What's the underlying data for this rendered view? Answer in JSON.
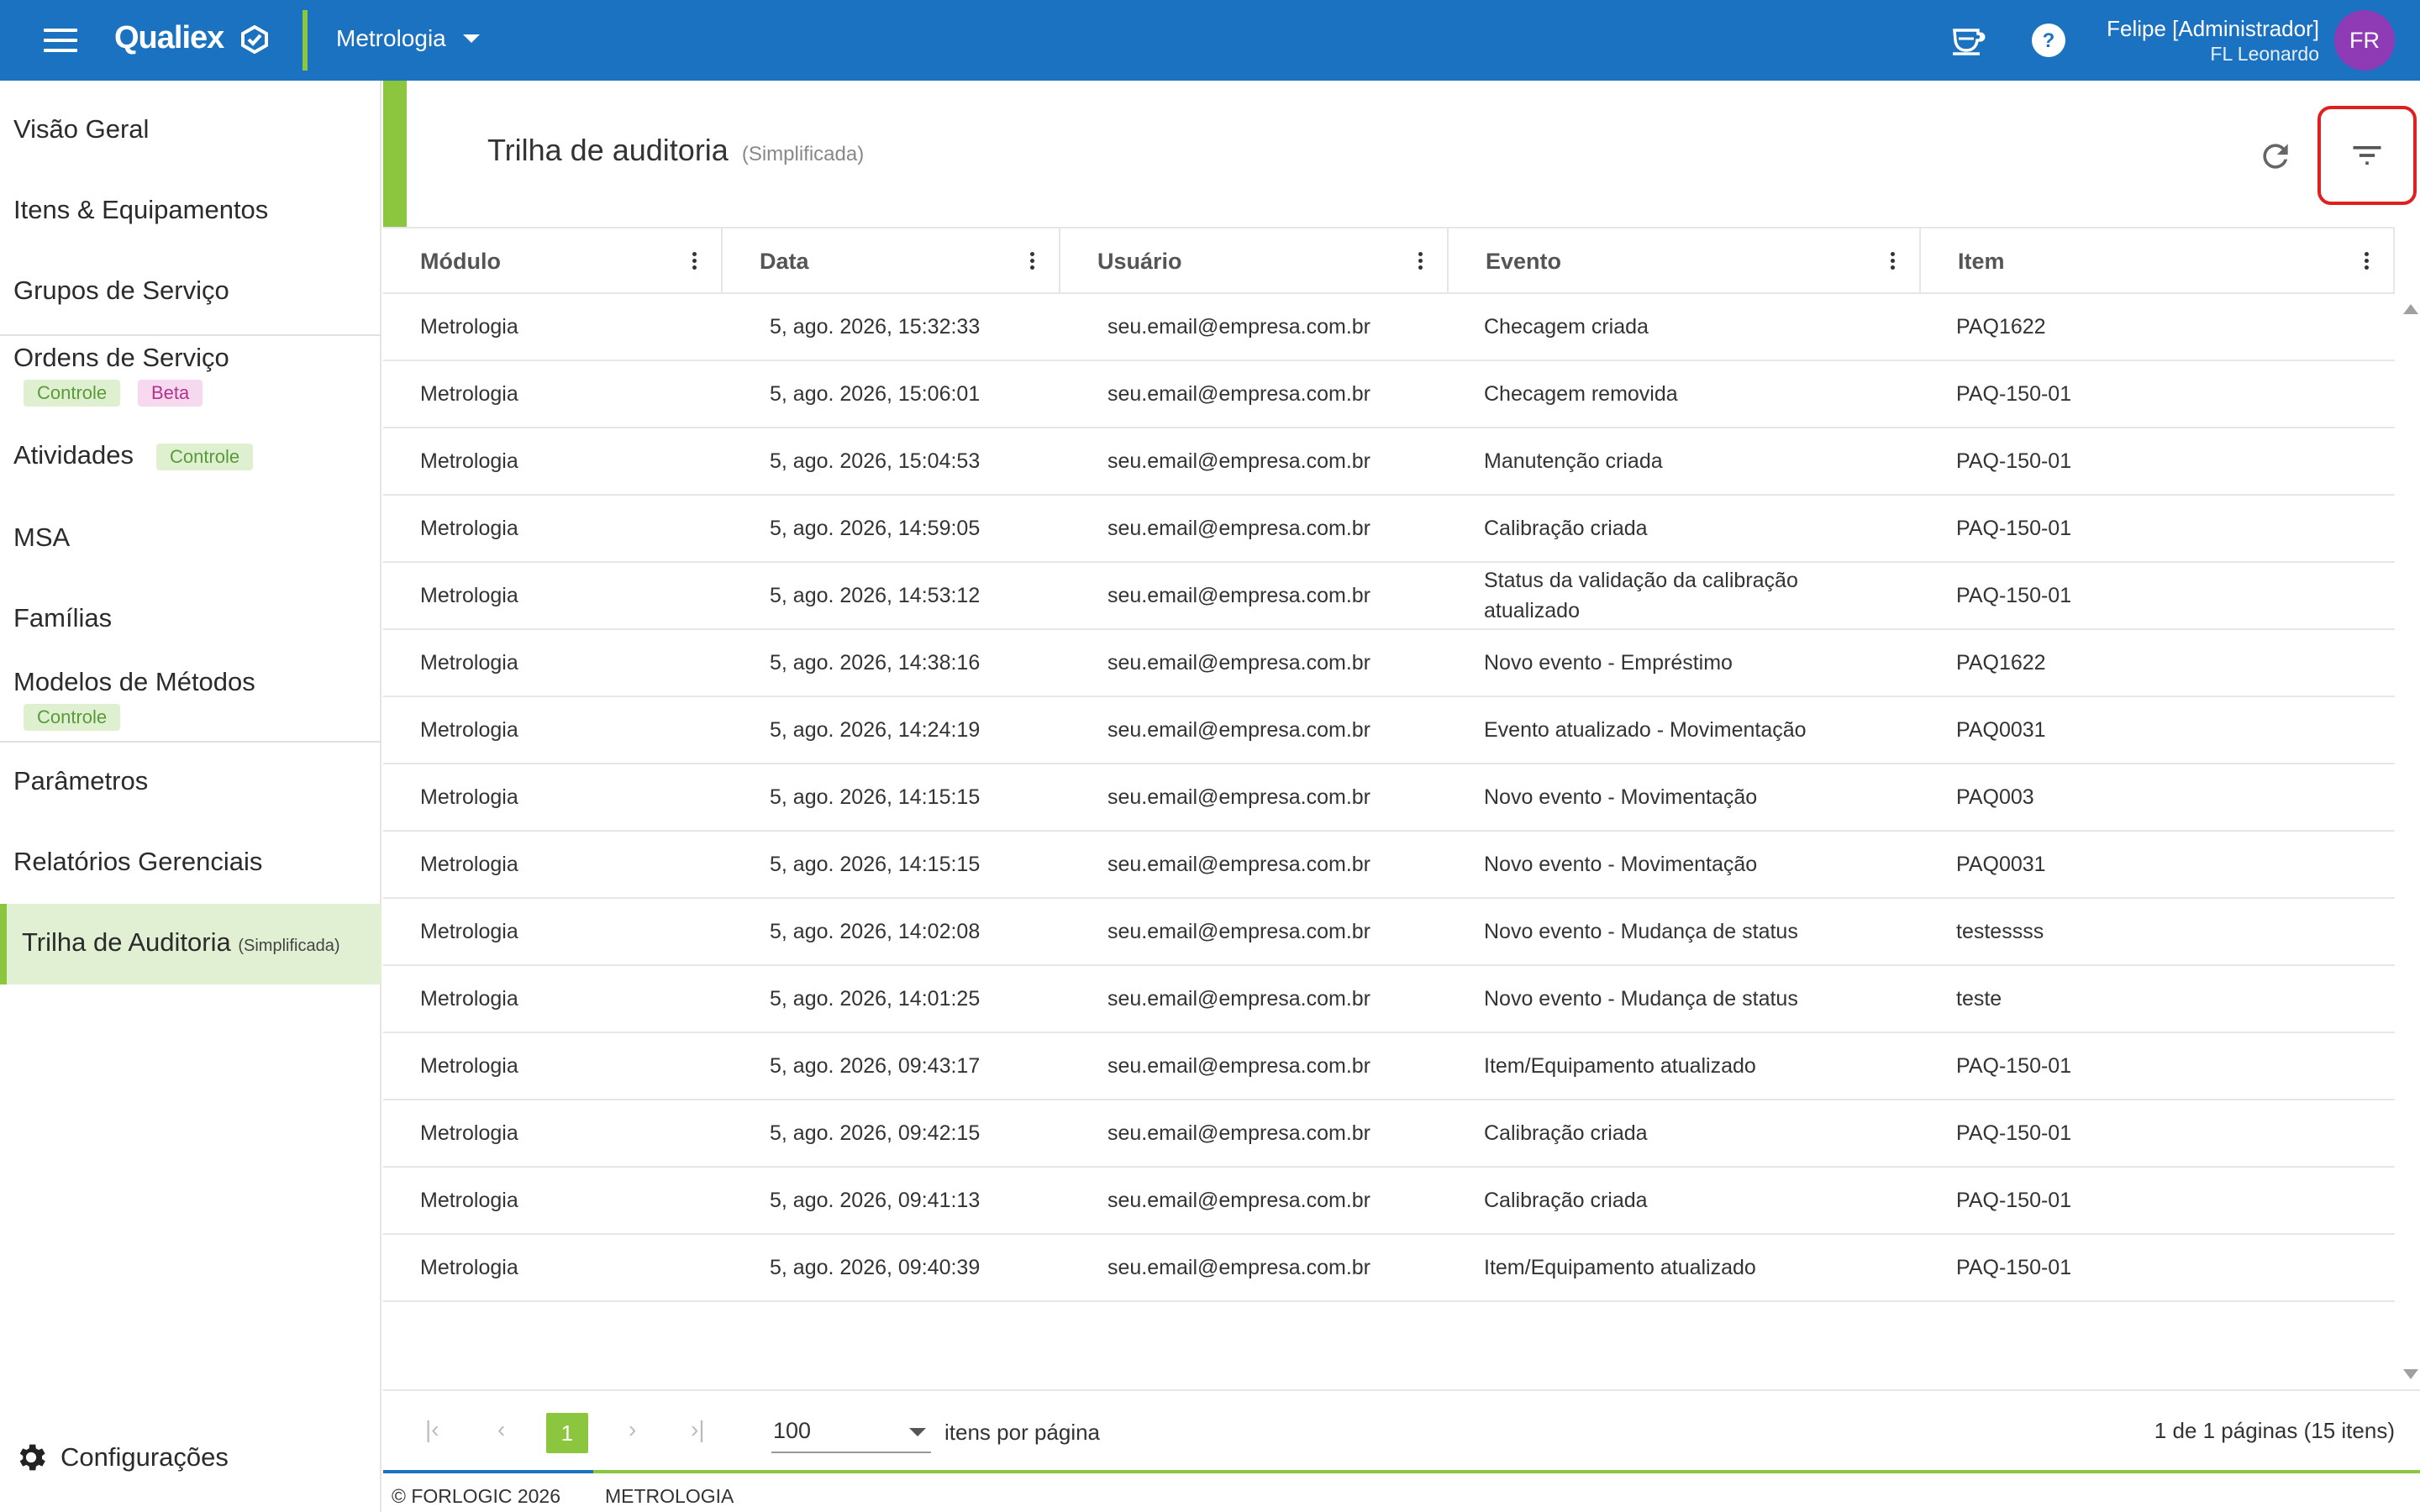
{
  "topbar": {
    "brand": "Qualiex",
    "module": "Metrologia",
    "user_name": "Felipe [Administrador]",
    "user_company": "FL Leonardo",
    "avatar_initials": "FR",
    "colors": {
      "bar": "#1b72c0",
      "accent": "#8cc63f",
      "avatar": "#8e3bb5"
    }
  },
  "sidebar": {
    "items": [
      {
        "label": "Visão Geral"
      },
      {
        "label": "Itens & Equipamentos"
      },
      {
        "label": "Grupos de Serviço"
      },
      {
        "label": "Ordens de Serviço",
        "badges": [
          "Controle",
          "Beta"
        ]
      },
      {
        "label": "Atividades",
        "badges": [
          "Controle"
        ]
      },
      {
        "label": "MSA"
      },
      {
        "label": "Famílias"
      },
      {
        "label": "Modelos de Métodos",
        "badges": [
          "Controle"
        ]
      },
      {
        "label": "Parâmetros"
      },
      {
        "label": "Relatórios Gerenciais"
      },
      {
        "label": "Trilha de Auditoria",
        "suffix": "(Simplificada)",
        "active": true
      }
    ],
    "settings_label": "Configurações"
  },
  "page": {
    "title": "Trilha de auditoria",
    "subtitle": "(Simplificada)"
  },
  "table": {
    "columns": [
      "Módulo",
      "Data",
      "Usuário",
      "Evento",
      "Item"
    ],
    "rows": [
      [
        "Metrologia",
        "5, ago. 2026, 15:32:33",
        "seu.email@empresa.com.br",
        "Checagem criada",
        "PAQ1622"
      ],
      [
        "Metrologia",
        "5, ago. 2026, 15:06:01",
        "seu.email@empresa.com.br",
        "Checagem removida",
        "PAQ-150-01"
      ],
      [
        "Metrologia",
        "5, ago. 2026, 15:04:53",
        "seu.email@empresa.com.br",
        "Manutenção criada",
        "PAQ-150-01"
      ],
      [
        "Metrologia",
        "5, ago. 2026, 14:59:05",
        "seu.email@empresa.com.br",
        "Calibração criada",
        "PAQ-150-01"
      ],
      [
        "Metrologia",
        "5, ago. 2026, 14:53:12",
        "seu.email@empresa.com.br",
        "Status da validação da calibração atualizado",
        "PAQ-150-01"
      ],
      [
        "Metrologia",
        "5, ago. 2026, 14:38:16",
        "seu.email@empresa.com.br",
        "Novo evento - Empréstimo",
        "PAQ1622"
      ],
      [
        "Metrologia",
        "5, ago. 2026, 14:24:19",
        "seu.email@empresa.com.br",
        "Evento atualizado - Movimentação",
        "PAQ0031"
      ],
      [
        "Metrologia",
        "5, ago. 2026, 14:15:15",
        "seu.email@empresa.com.br",
        "Novo evento - Movimentação",
        "PAQ003"
      ],
      [
        "Metrologia",
        "5, ago. 2026, 14:15:15",
        "seu.email@empresa.com.br",
        "Novo evento - Movimentação",
        "PAQ0031"
      ],
      [
        "Metrologia",
        "5, ago. 2026, 14:02:08",
        "seu.email@empresa.com.br",
        "Novo evento - Mudança de status",
        "testessss"
      ],
      [
        "Metrologia",
        "5, ago. 2026, 14:01:25",
        "seu.email@empresa.com.br",
        "Novo evento - Mudança de status",
        "teste"
      ],
      [
        "Metrologia",
        "5, ago. 2026, 09:43:17",
        "seu.email@empresa.com.br",
        "Item/Equipamento atualizado",
        "PAQ-150-01"
      ],
      [
        "Metrologia",
        "5, ago. 2026, 09:42:15",
        "seu.email@empresa.com.br",
        "Calibração criada",
        "PAQ-150-01"
      ],
      [
        "Metrologia",
        "5, ago. 2026, 09:41:13",
        "seu.email@empresa.com.br",
        "Calibração criada",
        "PAQ-150-01"
      ],
      [
        "Metrologia",
        "5, ago. 2026, 09:40:39",
        "seu.email@empresa.com.br",
        "Item/Equipamento atualizado",
        "PAQ-150-01"
      ]
    ]
  },
  "pagination": {
    "current_page": "1",
    "page_size": "100",
    "page_size_label": "itens por página",
    "info": "1 de 1 páginas (15 itens)"
  },
  "footer": {
    "copyright": "© FORLOGIC 2026",
    "module": "METROLOGIA"
  }
}
